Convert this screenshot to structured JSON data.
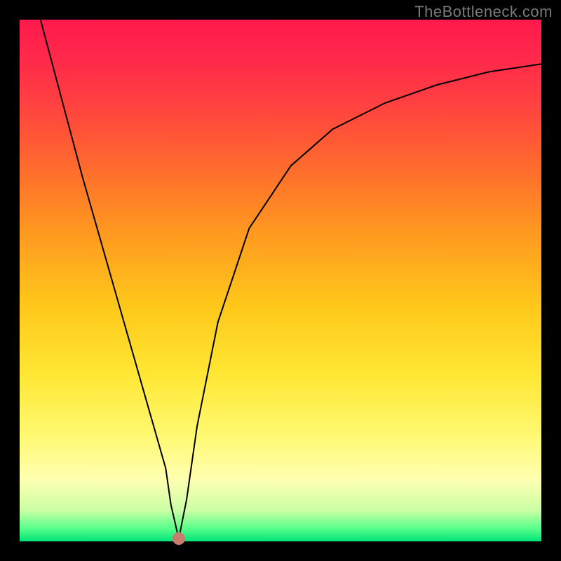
{
  "watermark": "TheBottleneck.com",
  "chart_data": {
    "type": "line",
    "title": "",
    "xlabel": "",
    "ylabel": "",
    "xlim": [
      0,
      100
    ],
    "ylim": [
      0,
      100
    ],
    "series": [
      {
        "name": "bottleneck-curve",
        "x": [
          4,
          8,
          12,
          16,
          20,
          24,
          28,
          29,
          30.5,
          32,
          34,
          38,
          44,
          52,
          60,
          70,
          80,
          90,
          100
        ],
        "values": [
          100,
          85,
          70,
          56,
          42,
          28,
          14,
          7,
          0.5,
          8,
          22,
          42,
          60,
          72,
          79,
          84,
          87.5,
          90,
          91.5
        ]
      }
    ],
    "marker": {
      "x": 30.5,
      "y": 0.5,
      "color": "#c97b6e"
    },
    "background_gradient": {
      "top": "#ff1a4d",
      "mid": "#ffe733",
      "bottom": "#00e47a"
    }
  }
}
